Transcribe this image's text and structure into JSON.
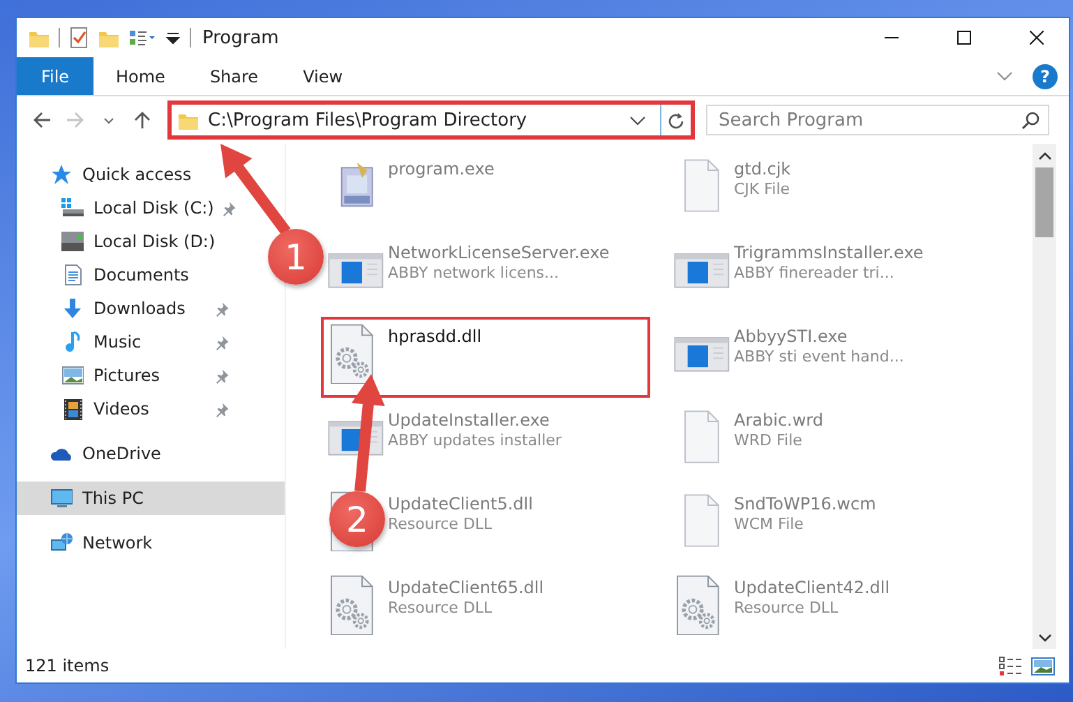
{
  "window": {
    "title": "Program"
  },
  "ribbon": {
    "tabs": [
      {
        "label": "File",
        "kind": "file"
      },
      {
        "label": "Home",
        "kind": "tab"
      },
      {
        "label": "Share",
        "kind": "tab"
      },
      {
        "label": "View",
        "kind": "tab"
      }
    ],
    "help": "?"
  },
  "address_bar": {
    "path": "C:\\Program Files\\Program Directory",
    "highlighted": true
  },
  "search": {
    "placeholder": "Search Program"
  },
  "sidebar": {
    "items": [
      {
        "label": "Quick access",
        "selected": false,
        "children": [
          {
            "label": "Local Disk (C:)",
            "pinned": true,
            "selected": false
          },
          {
            "label": "Local Disk (D:)",
            "pinned": false,
            "selected": false
          },
          {
            "label": "Documents",
            "pinned": false,
            "selected": false
          },
          {
            "label": "Downloads",
            "pinned": true,
            "selected": false
          },
          {
            "label": "Music",
            "pinned": true,
            "selected": false
          },
          {
            "label": "Pictures",
            "pinned": true,
            "selected": false
          },
          {
            "label": "Videos",
            "pinned": true,
            "selected": false
          }
        ]
      },
      {
        "label": "OneDrive",
        "selected": false
      },
      {
        "label": "This PC",
        "selected": true
      },
      {
        "label": "Network",
        "selected": false
      }
    ]
  },
  "files": [
    {
      "name": "program.exe",
      "kind": "setup",
      "highlighted": false
    },
    {
      "name": "gtd.cjk",
      "type": "CJK File",
      "kind": "blank",
      "highlighted": false
    },
    {
      "name": "NetworkLicenseServer.exe",
      "type": "ABBY network licens...",
      "kind": "app",
      "highlighted": false
    },
    {
      "name": "TrigrammsInstaller.exe",
      "type": "ABBY finereader tri...",
      "kind": "app",
      "highlighted": false
    },
    {
      "name": "hprasdd.dll",
      "kind": "dll",
      "highlighted": true
    },
    {
      "name": "AbbyySTI.exe",
      "type": "ABBY sti event hand...",
      "kind": "app",
      "highlighted": false
    },
    {
      "name": "UpdateInstaller.exe",
      "type": "ABBY updates installer",
      "kind": "app",
      "highlighted": false
    },
    {
      "name": "Arabic.wrd",
      "type": "WRD File",
      "kind": "blank",
      "highlighted": false
    },
    {
      "name": "UpdateClient5.dll",
      "type": "Resource DLL",
      "kind": "dll",
      "highlighted": false
    },
    {
      "name": "SndToWP16.wcm",
      "type": "WCM File",
      "kind": "blank",
      "highlighted": false
    },
    {
      "name": "UpdateClient65.dll",
      "type": "Resource DLL",
      "kind": "dll",
      "highlighted": false
    },
    {
      "name": "UpdateClient42.dll",
      "type": "Resource DLL",
      "kind": "dll",
      "highlighted": false
    }
  ],
  "status_bar": {
    "count": "121 items"
  },
  "callouts": [
    {
      "label": "1"
    },
    {
      "label": "2"
    }
  ]
}
